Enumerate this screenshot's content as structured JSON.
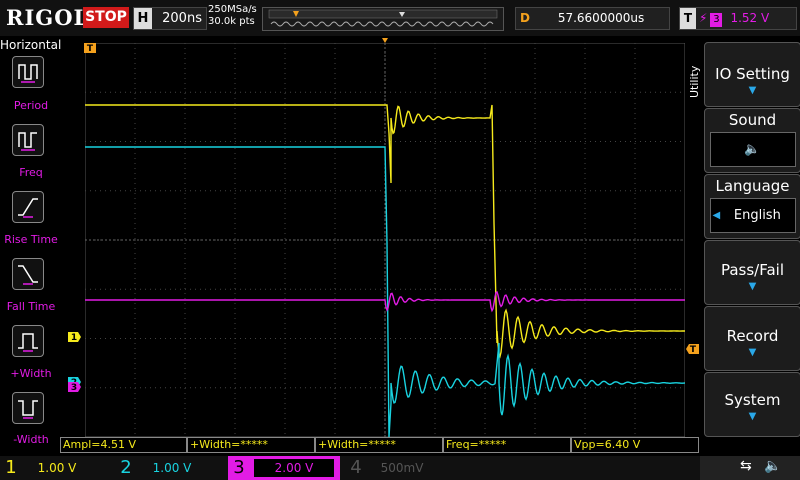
{
  "topbar": {
    "logo": "RIGOL",
    "run_state": "STOP",
    "horizontal_letter": "H",
    "timebase": "200ns",
    "sample_rate": "250MSa/s",
    "memory_points": "30.0k pts",
    "delay_letter": "D",
    "delay_value": "57.6600000us",
    "trigger_letter": "T",
    "trigger_source": "3",
    "trigger_level": "1.52 V"
  },
  "left_menu": {
    "title": "Horizontal",
    "items": [
      {
        "label": "Period",
        "icon": "period-icon"
      },
      {
        "label": "Freq",
        "icon": "frequency-icon"
      },
      {
        "label": "Rise Time",
        "icon": "rise-time-icon"
      },
      {
        "label": "Fall Time",
        "icon": "fall-time-icon"
      },
      {
        "label": "+Width",
        "icon": "positive-width-icon"
      },
      {
        "label": "-Width",
        "icon": "negative-width-icon"
      }
    ]
  },
  "right_menu": {
    "side_label": "Utility",
    "io_setting": "IO Setting",
    "sound": "Sound",
    "language": "Language",
    "language_value": "English",
    "pass_fail": "Pass/Fail",
    "record": "Record",
    "system": "System"
  },
  "measurements": {
    "ampl": "Ampl=4.51 V",
    "pos_width_1": "+Width=*****",
    "pos_width_2": "+Width=*****",
    "freq": "Freq=*****",
    "vpp": "Vpp=6.40 V"
  },
  "channels": [
    {
      "num": "1",
      "scale": "1.00 V",
      "color": "#f6ea1c"
    },
    {
      "num": "2",
      "scale": "1.00 V",
      "color": "#19d3e0"
    },
    {
      "num": "3",
      "scale": "2.00 V",
      "color": "#e21ce5"
    },
    {
      "num": "4",
      "scale": "500mV",
      "color": "#3e61d9"
    }
  ],
  "markers": {
    "ch1": "1",
    "ch2": "2",
    "ch3": "3",
    "trigger": "T"
  },
  "colors": {
    "ch1": "#f6ea1c",
    "ch2": "#19d3e0",
    "ch3": "#e21ce5",
    "trigger": "#f4a11d",
    "stop": "#d11a1a"
  }
}
